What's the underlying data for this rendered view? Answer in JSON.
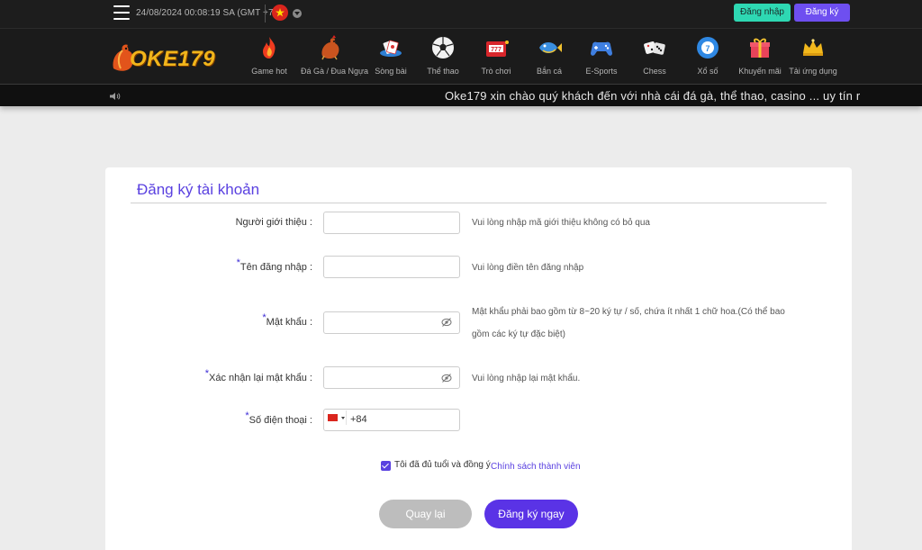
{
  "topbar": {
    "datetime": "24/08/2024 00:08:19 SA (GMT +7)",
    "login_label": "Đăng nhập",
    "register_label": "Đăng ký"
  },
  "logo": {
    "text": "OKE179"
  },
  "nav": {
    "items": [
      {
        "label": "Game hot",
        "icon": "flame-icon"
      },
      {
        "label": "Đá Gà / Đua Ngựa",
        "icon": "rooster-icon"
      },
      {
        "label": "Sòng bài",
        "icon": "casino-icon"
      },
      {
        "label": "Thể thao",
        "icon": "soccer-ball-icon"
      },
      {
        "label": "Trò chơi",
        "icon": "slot-machine-icon"
      },
      {
        "label": "Bắn cá",
        "icon": "fish-icon"
      },
      {
        "label": "E-Sports",
        "icon": "gamepad-icon"
      },
      {
        "label": "Chess",
        "icon": "dice-icon"
      },
      {
        "label": "Xổ số",
        "icon": "lottery-ball-icon"
      },
      {
        "label": "Khuyến mãi",
        "icon": "gift-icon"
      },
      {
        "label": "Tải ứng dụng",
        "icon": "crown-icon"
      }
    ]
  },
  "marquee": {
    "text": "Oke179 xin chào quý khách đến với nhà cái đá gà, thể thao, casino ... uy tín r"
  },
  "form": {
    "title": "Đăng ký tài khoản",
    "required_mark": "*",
    "fields": {
      "referrer": {
        "label": "Người giới thiệu   :",
        "value": "",
        "hint": "Vui lòng nhập mã giới thiệu không có bỏ qua"
      },
      "username": {
        "label": "Tên đăng nhập   :",
        "value": "",
        "hint": "Vui lòng điền tên đăng nhập"
      },
      "password": {
        "label": "Mật khẩu   :",
        "value": "",
        "hint_line1": "Mật khẩu phải bao gồm từ 8~20 ký tự / số, chứa ít nhất 1 chữ hoa.(Có thể bao",
        "hint_line2": "gồm các ký tự đặc biệt)"
      },
      "confirm_password": {
        "label": "Xác nhận lại mật khẩu   :",
        "value": "",
        "hint": "Vui lòng nhập lại mật khẩu."
      },
      "phone": {
        "label": "Số điện thoại   :",
        "country_code": "+84"
      }
    },
    "agree": {
      "checked": true,
      "text": "Tôi đã đủ tuổi và đồng ý",
      "link": "Chính sách thành viên"
    },
    "back_label": "Quay lại",
    "submit_label": "Đăng ký ngay"
  },
  "colors": {
    "accent": "#5a41e0",
    "login_button": "#2ed8b3",
    "register_button": "#6e4ff0",
    "back_button": "#bdbdbd"
  }
}
